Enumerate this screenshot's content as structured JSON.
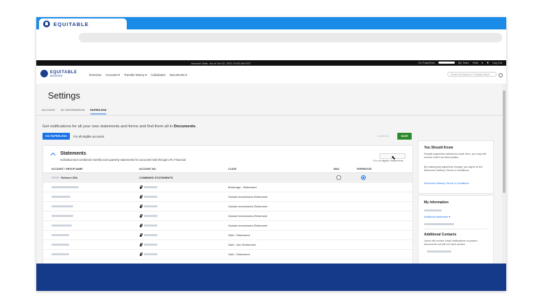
{
  "browser": {
    "tab_title": "EQUITABLE"
  },
  "util_bar": {
    "center_text": "Account Data : As of Oct 22, 2021 10:00 AM EST",
    "go_paperless": "Go Paperless",
    "my_team": "My Team",
    "help": "Help",
    "logout": "Log Out"
  },
  "nav": {
    "brand_name": "EQUITABLE",
    "brand_sub": "ADVISORS",
    "menu": [
      "Overview",
      "Accounts",
      "Transfer Money",
      "Calculators",
      "Documents"
    ],
    "search_placeholder": "Search by Symbol or Company Name"
  },
  "page": {
    "title": "Settings",
    "tabs": [
      "ACCOUNT",
      "MY INFORMATION",
      "PAPERLESS"
    ],
    "active_tab": "PAPERLESS",
    "notice_prefix": "Get notifications for all your new statements and forms and find them all in ",
    "notice_bold": "Documents",
    "notice_suffix": ".",
    "go_paperless_button": "GO PAPERLESS",
    "eligible_text": "For all eligible accounts",
    "cancel_label": "CANCEL",
    "save_label": "SAVE"
  },
  "statements": {
    "title": "Statements",
    "description": "Individual and combined monthly and quarterly statements for accounts held through LPL Financial",
    "for_all_text": "For all eligible Statements",
    "columns": [
      "ACCOUNT / GROUP NAME",
      "ACCOUNT NO.",
      "CLASS",
      "MAIL",
      "PAPERLESS"
    ],
    "combined_row": {
      "name": "Rollover IRA",
      "account_no": "COMBINED STATEMENTS"
    },
    "rows": [
      {
        "class": "Brokerage - Retirement"
      },
      {
        "class": "Outside Investments-Retirement"
      },
      {
        "class": "Outside Investments-Retirement"
      },
      {
        "class": "Outside Investments-Retirement"
      },
      {
        "class": "Outside Investments-Retirement"
      },
      {
        "class": "SAM - Retirement"
      },
      {
        "class": "SAM - Non Retirement"
      },
      {
        "class": "SAM - Retirement"
      }
    ]
  },
  "sidebar": {
    "know_title": "You Should Know",
    "know_p1": "Despite paperless selections made here, you may still receive mail from third parties.",
    "know_p2": "By making any paperless change, you agree to the Electronic Delivery Terms & Conditions.",
    "know_link": "Electronic Delivery Terms & Conditions",
    "info_title": "My Information",
    "info_link": "Additional addresses",
    "contacts_title": "Additional Contacts",
    "contacts_p": "Users will receive email notifications of posted documents but will not have access"
  },
  "colors": {
    "brand_blue": "#1b3f8c",
    "accent_blue": "#1a73e8",
    "save_green": "#2c8a2c",
    "footer_navy": "#153a8a",
    "chrome_blue": "#1a8ce8"
  }
}
